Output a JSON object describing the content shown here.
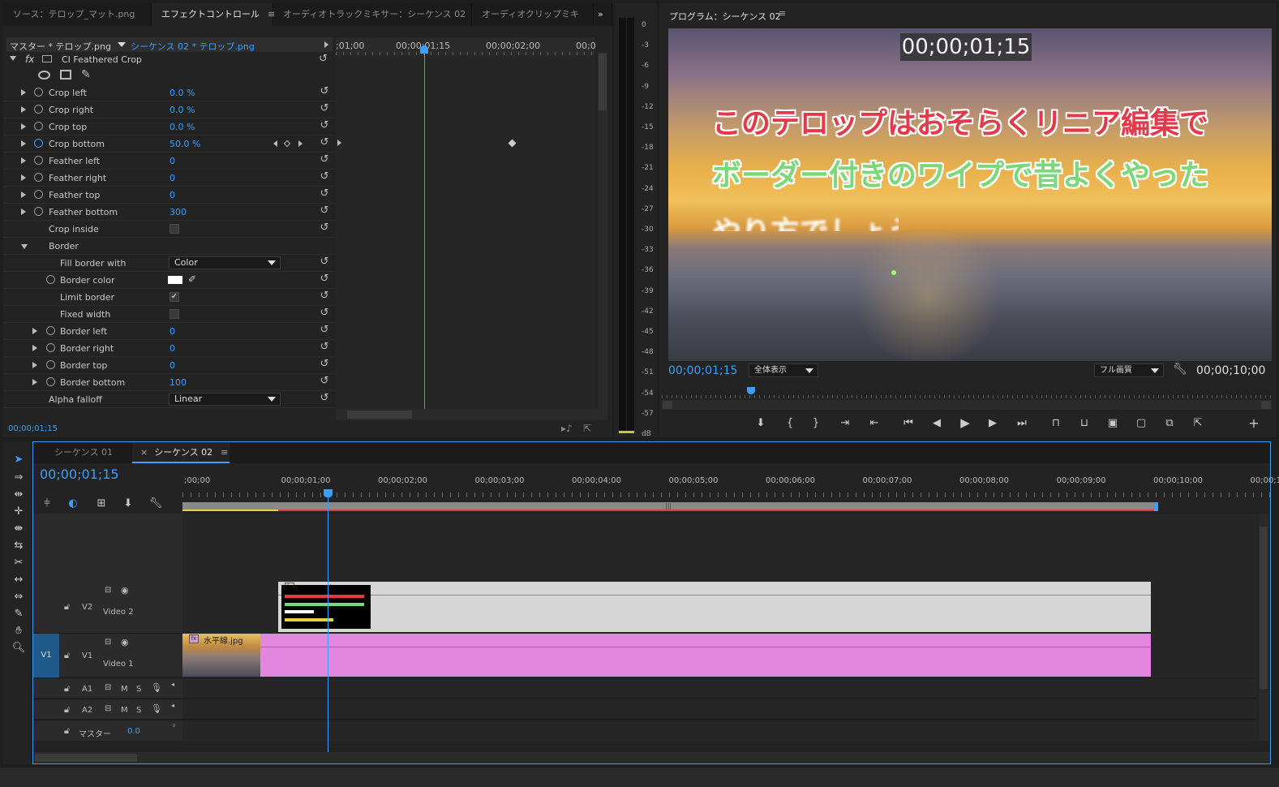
{
  "top_tabs": {
    "source": "ソース：テロップ_マット.png",
    "effect_controls": "エフェクトコントロール",
    "audio_track_mixer": "オーディオトラックミキサー：シーケンス 02",
    "audio_clip_mixer": "オーディオクリップミキ",
    "overflow": "»"
  },
  "effect_controls": {
    "master_clip": "マスター * テロップ.png",
    "sequence_clip": "シーケンス 02 * テロップ.png",
    "fx_label": "fx",
    "effect_name": "CI Feathered Crop",
    "timecodes": [
      ";01;00",
      "00;00;01;15",
      "00;00;02;00",
      "00;0"
    ],
    "footer_timecode": "00;00;01;15",
    "params": [
      {
        "label": "Crop left",
        "value": "0.0 %"
      },
      {
        "label": "Crop right",
        "value": "0.0 %"
      },
      {
        "label": "Crop top",
        "value": "0.0 %"
      },
      {
        "label": "Crop bottom",
        "value": "50.0 %"
      },
      {
        "label": "Feather left",
        "value": "0"
      },
      {
        "label": "Feather right",
        "value": "0"
      },
      {
        "label": "Feather top",
        "value": "0"
      },
      {
        "label": "Feather bottom",
        "value": "300"
      }
    ],
    "crop_inside": "Crop inside",
    "border_group": "Border",
    "fill_border_with": {
      "label": "Fill border with",
      "value": "Color"
    },
    "border_color": "Border color",
    "limit_border": "Limit border",
    "fixed_width": "Fixed width",
    "border_params": [
      {
        "label": "Border left",
        "value": "0"
      },
      {
        "label": "Border right",
        "value": "0"
      },
      {
        "label": "Border top",
        "value": "0"
      },
      {
        "label": "Border bottom",
        "value": "100"
      }
    ],
    "alpha_falloff": {
      "label": "Alpha falloff",
      "value": "Linear"
    }
  },
  "meter": {
    "labels": [
      "0",
      "-3",
      "-6",
      "-9",
      "-12",
      "-15",
      "-18",
      "-21",
      "-24",
      "-27",
      "-30",
      "-33",
      "-36",
      "-39",
      "-42",
      "-45",
      "-48",
      "-51",
      "-54",
      "-57",
      "dB"
    ]
  },
  "program": {
    "title": "プログラム：シーケンス 02",
    "overlay_timecode": "00;00;01;15",
    "caption_line1": "このテロップはおそらくリニア編集で",
    "caption_line2": "ボーダー付きのワイプで昔よくやった",
    "caption_line3": "やり方でしょうか",
    "current_timecode": "00;00;01;15",
    "zoom": "全体表示",
    "quality": "フル画質",
    "duration": "00;00;10;00"
  },
  "timeline": {
    "tabs": [
      "シーケンス 01",
      "シーケンス 02"
    ],
    "current_timecode": "00;00;01;15",
    "ruler": [
      ";00;00",
      "00;00;01;00",
      "00;00;02;00",
      "00;00;03;00",
      "00;00;04;00",
      "00;00;05;00",
      "00;00;06;00",
      "00;00;07;00",
      "00;00;08;00",
      "00;00;09;00",
      "00;00;10;00",
      "00;00;1:"
    ],
    "tracks": {
      "v2": {
        "id": "V2",
        "name": "Video 2"
      },
      "v1": {
        "src": "V1",
        "id": "V1",
        "name": "Video 1"
      },
      "a1": {
        "id": "A1",
        "m": "M",
        "s": "S"
      },
      "a2": {
        "id": "A2",
        "m": "M",
        "s": "S"
      },
      "master": {
        "label": "マスター",
        "value": "0.0"
      }
    },
    "clips": {
      "telop": "テロップ.png",
      "horizon": "水平線.jpg"
    }
  },
  "colors": {
    "accent": "#3aa0ff",
    "clip_pink": "#e386e0",
    "clip_gray": "#d6d6d6",
    "work_red": "#e03a3a",
    "work_yellow": "#e6d23a"
  }
}
